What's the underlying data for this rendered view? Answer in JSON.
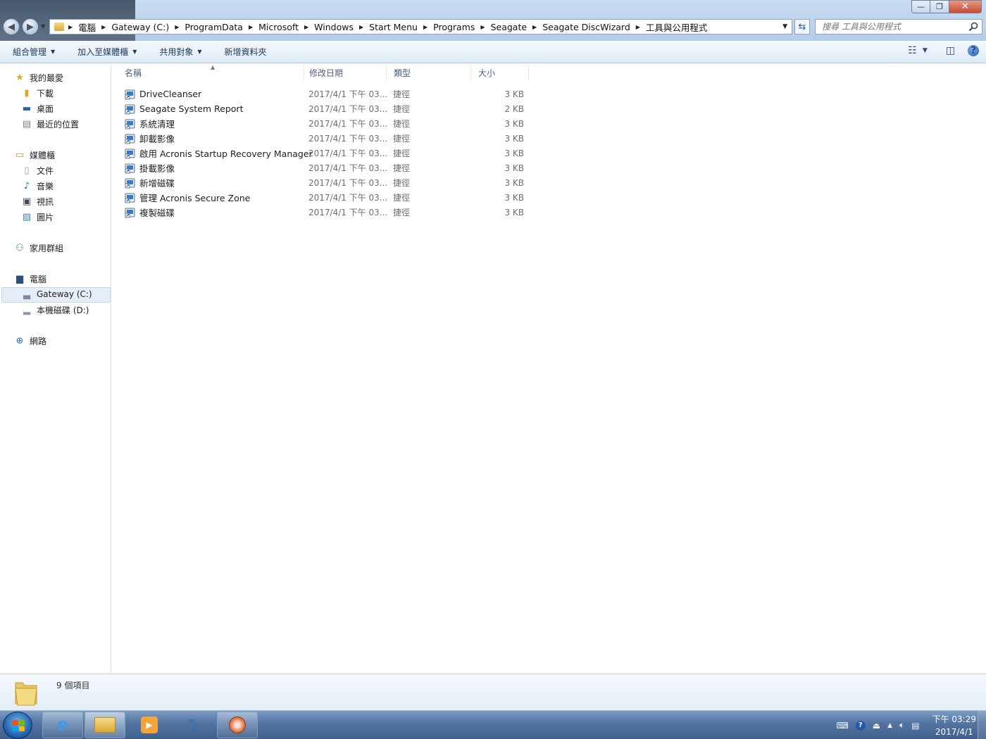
{
  "window": {
    "minimize": "—",
    "maximize": "❐",
    "close": "✕"
  },
  "address": {
    "crumbs": [
      "電腦",
      "Gateway (C:)",
      "ProgramData",
      "Microsoft",
      "Windows",
      "Start Menu",
      "Programs",
      "Seagate",
      "Seagate DiscWizard",
      "工具與公用程式"
    ]
  },
  "search": {
    "placeholder": "搜尋 工具與公用程式"
  },
  "toolbar": {
    "organize": "組合管理",
    "include_library": "加入至媒體櫃",
    "share_with": "共用對象",
    "new_folder": "新增資料夾"
  },
  "nav": {
    "favorites": "我的最愛",
    "downloads": "下載",
    "desktop": "桌面",
    "recent": "最近的位置",
    "libraries": "媒體櫃",
    "documents": "文件",
    "music": "音樂",
    "videos": "視訊",
    "pictures": "圖片",
    "homegroup": "家用群組",
    "computer": "電腦",
    "drive_c": "Gateway (C:)",
    "drive_d": "本機磁碟 (D:)",
    "network": "網路"
  },
  "columns": {
    "name": "名稱",
    "date": "修改日期",
    "type": "類型",
    "size": "大小"
  },
  "files": [
    {
      "name": "DriveCleanser",
      "date": "2017/4/1 下午 03...",
      "type": "捷徑",
      "size": "3 KB"
    },
    {
      "name": "Seagate System Report",
      "date": "2017/4/1 下午 03...",
      "type": "捷徑",
      "size": "2 KB"
    },
    {
      "name": "系統清理",
      "date": "2017/4/1 下午 03...",
      "type": "捷徑",
      "size": "3 KB"
    },
    {
      "name": "卸載影像",
      "date": "2017/4/1 下午 03...",
      "type": "捷徑",
      "size": "3 KB"
    },
    {
      "name": "啟用 Acronis Startup Recovery Manager",
      "date": "2017/4/1 下午 03...",
      "type": "捷徑",
      "size": "3 KB"
    },
    {
      "name": "掛載影像",
      "date": "2017/4/1 下午 03...",
      "type": "捷徑",
      "size": "3 KB"
    },
    {
      "name": "新增磁碟",
      "date": "2017/4/1 下午 03...",
      "type": "捷徑",
      "size": "3 KB"
    },
    {
      "name": "管理 Acronis Secure Zone",
      "date": "2017/4/1 下午 03...",
      "type": "捷徑",
      "size": "3 KB"
    },
    {
      "name": "複製磁碟",
      "date": "2017/4/1 下午 03...",
      "type": "捷徑",
      "size": "3 KB"
    }
  ],
  "details": {
    "item_count": "9 個項目"
  },
  "taskbar": {
    "time": "下午 03:29",
    "date": "2017/4/1"
  }
}
